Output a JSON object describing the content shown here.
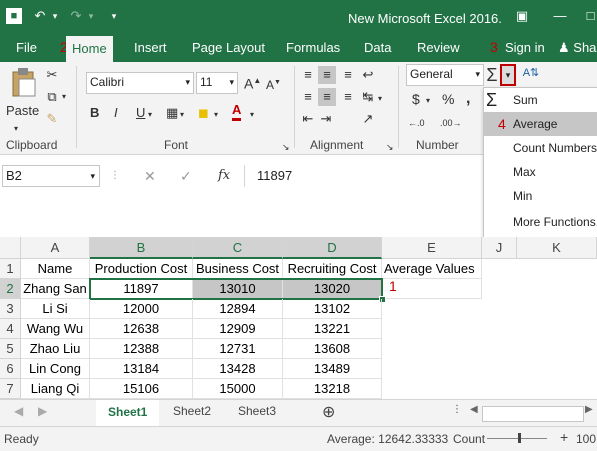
{
  "window": {
    "title": "New Microsoft Excel 2016."
  },
  "tabs": [
    "File",
    "Home",
    "Insert",
    "Page Layout",
    "Formulas",
    "Data",
    "Review"
  ],
  "sign_in": "Sign in",
  "share": "Sha",
  "annotations": {
    "home": "2",
    "sum_dropdown": "3",
    "average": "4",
    "cell": "1"
  },
  "ribbon": {
    "paste_label": "Paste",
    "font_name": "Calibri",
    "font_size": "11",
    "number_format": "General",
    "groups": {
      "clipboard": "Clipboard",
      "font": "Font",
      "alignment": "Alignment",
      "number": "Number"
    },
    "bold": "B",
    "italic": "I",
    "underline": "U",
    "currency": "$",
    "percent": "%"
  },
  "formula_bar": {
    "name_box": "B2",
    "fx": "fx",
    "value": "11897"
  },
  "autosum_menu": [
    "Sum",
    "Average",
    "Count Numbers",
    "Max",
    "Min",
    "More Functions..."
  ],
  "grid": {
    "columns": [
      "A",
      "B",
      "C",
      "D",
      "E",
      "J",
      "K"
    ],
    "rows": [
      "1",
      "2",
      "3",
      "4",
      "5",
      "6",
      "7"
    ],
    "header_row": [
      "Name",
      "Production Cost",
      "Business Cost",
      "Recruiting Cost",
      "Average Values"
    ],
    "data": [
      [
        "Zhang San",
        "11897",
        "13010",
        "13020"
      ],
      [
        "Li Si",
        "12000",
        "12894",
        "13102"
      ],
      [
        "Wang Wu",
        "12638",
        "12909",
        "13221"
      ],
      [
        "Zhao Liu",
        "12388",
        "12731",
        "13608"
      ],
      [
        "Lin Cong",
        "13184",
        "13428",
        "13489"
      ],
      [
        "Liang Qi",
        "15106",
        "15000",
        "13218"
      ]
    ]
  },
  "sheets": [
    "Sheet1",
    "Sheet2",
    "Sheet3"
  ],
  "status": {
    "ready": "Ready",
    "average": "Average: 12642.33333",
    "count": "Count",
    "zoom": "100"
  },
  "colors": {
    "accent": "#217346",
    "annotation": "#c00000"
  }
}
